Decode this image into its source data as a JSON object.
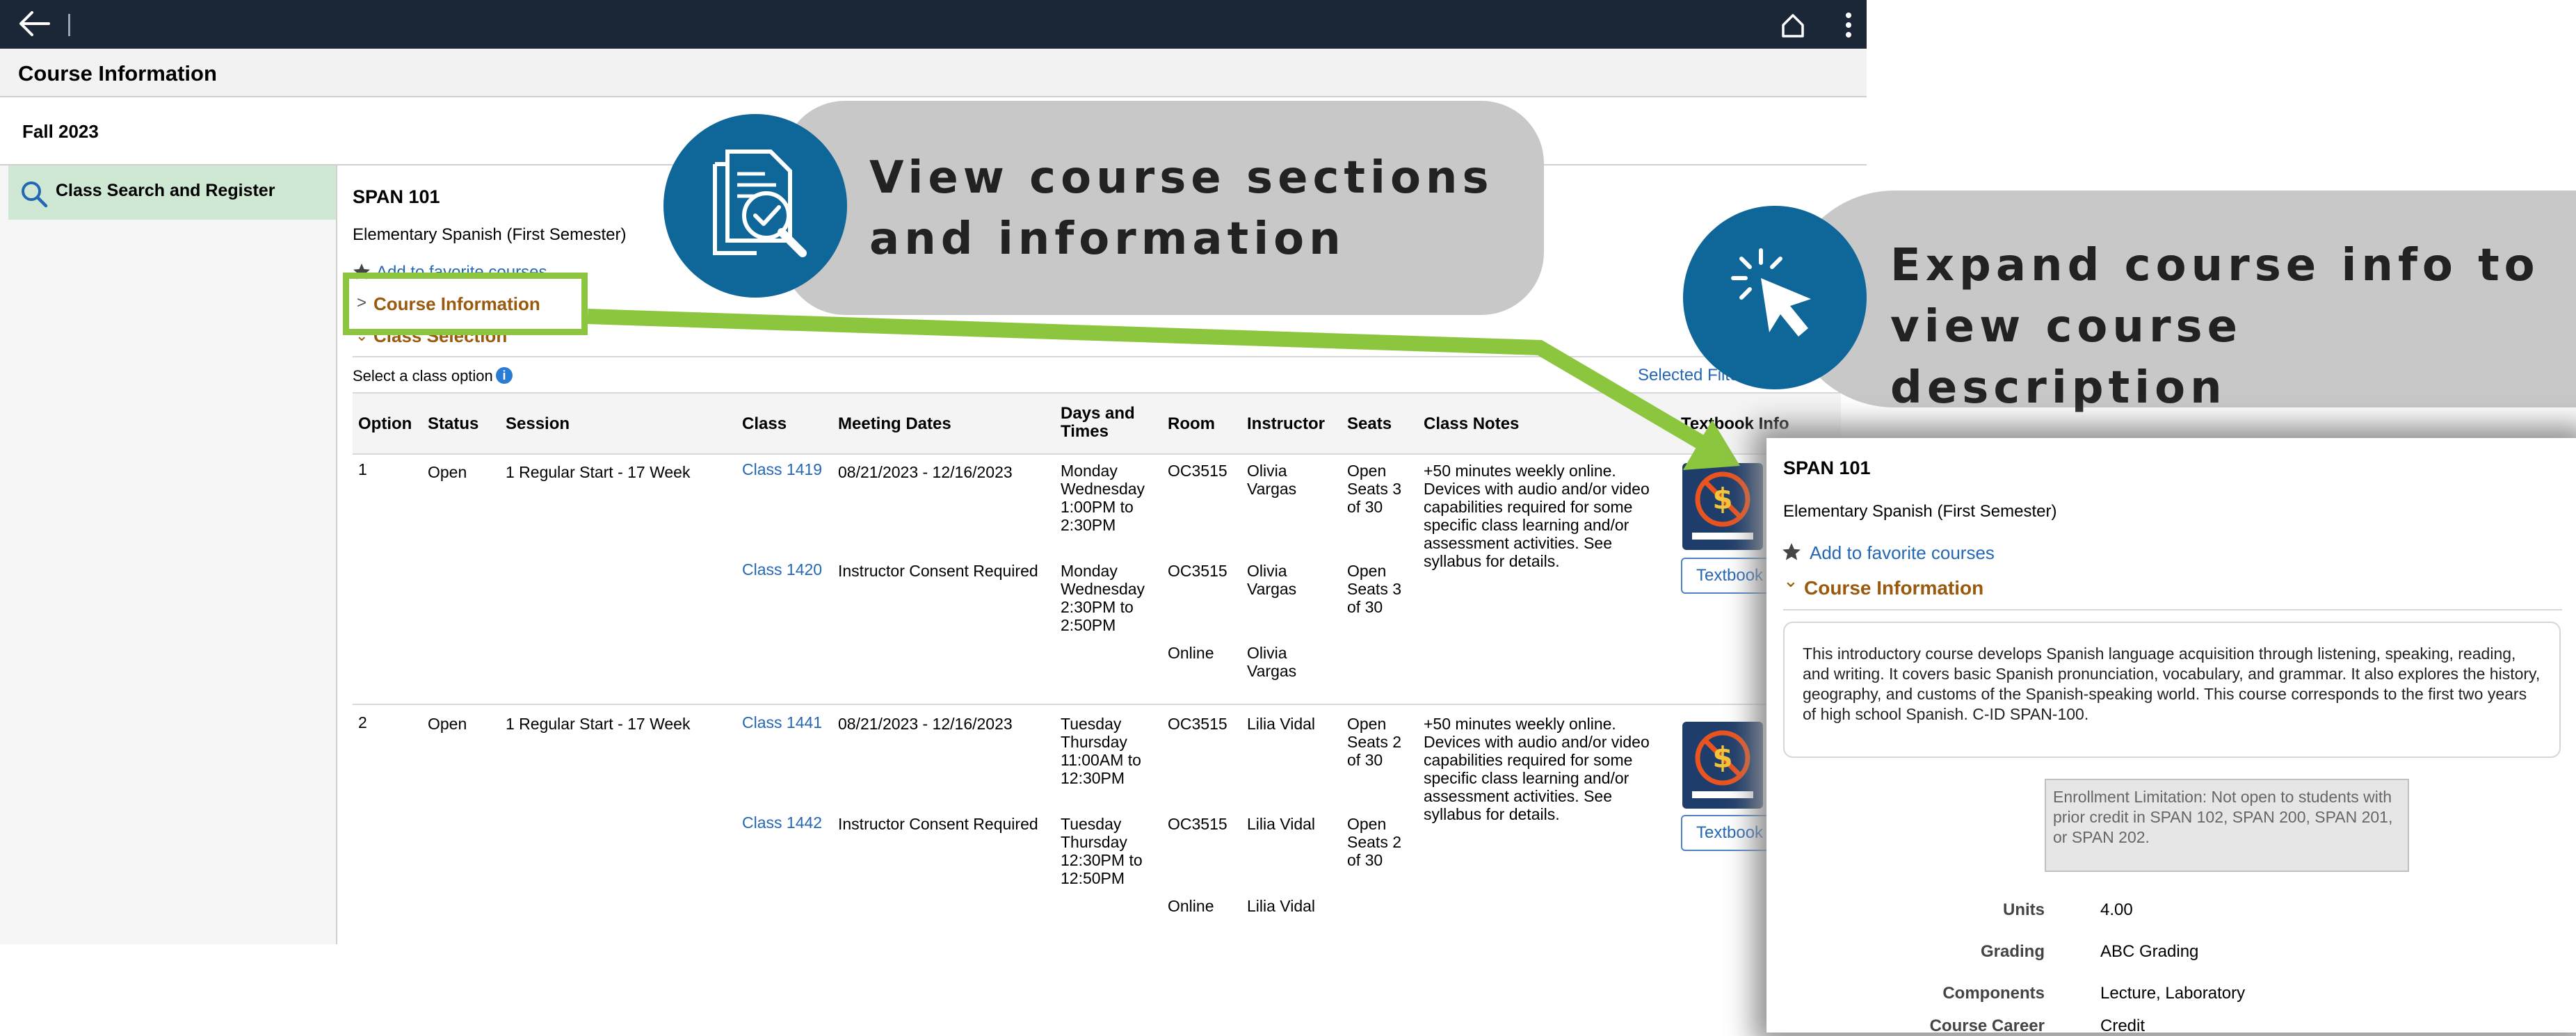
{
  "app": {
    "header_title": "Course Information",
    "term": "Fall 2023",
    "sidebar_item": "Class Search and Register"
  },
  "course": {
    "code": "SPAN 101",
    "title": "Elementary Spanish (First Semester)",
    "favorite_link": "Add to favorite courses",
    "course_info_label": "Course Information",
    "class_selection_label": "Class Selection",
    "select_option": "Select a class option",
    "selected_filters": "Selected Filters"
  },
  "table": {
    "headers": [
      "Option",
      "Status",
      "Session",
      "Class",
      "Meeting Dates",
      "Days and Times",
      "Room",
      "Instructor",
      "Seats",
      "Class Notes",
      "Textbook Info"
    ],
    "textbook_button": "Textbook Info",
    "rows": [
      {
        "option": "1",
        "status": "Open",
        "session": "1 Regular Start - 17 Week",
        "notes": "+50 minutes weekly online. Devices with audio and/or video capabilities required for some specific class learning and/or assessment activities. See syllabus for details.",
        "sections": [
          {
            "class": "Class 1419",
            "dates": "08/21/2023 - 12/16/2023",
            "days": "Monday Wednesday 1:00PM to 2:30PM",
            "room": "OC3515",
            "instructor": "Olivia Vargas",
            "seats": "Open Seats 3 of 30"
          },
          {
            "class": "Class 1420",
            "dates": "Instructor Consent Required",
            "days": "Monday Wednesday 2:30PM to 2:50PM",
            "room": "OC3515",
            "instructor": "Olivia Vargas",
            "seats": "Open Seats 3 of 30"
          },
          {
            "class": "",
            "dates": "",
            "days": "",
            "room": "Online",
            "instructor": "Olivia Vargas",
            "seats": ""
          }
        ]
      },
      {
        "option": "2",
        "status": "Open",
        "session": "1 Regular Start - 17 Week",
        "notes": "+50 minutes weekly online. Devices with audio and/or video capabilities required for some specific class learning and/or assessment activities. See syllabus for details.",
        "sections": [
          {
            "class": "Class 1441",
            "dates": "08/21/2023 - 12/16/2023",
            "days": "Tuesday Thursday 11:00AM to 12:30PM",
            "room": "OC3515",
            "instructor": "Lilia Vidal",
            "seats": "Open Seats 2 of 30"
          },
          {
            "class": "Class 1442",
            "dates": "Instructor Consent Required",
            "days": "Tuesday Thursday 12:30PM to 12:50PM",
            "room": "OC3515",
            "instructor": "Lilia Vidal",
            "seats": "Open Seats 2 of 30"
          },
          {
            "class": "",
            "dates": "",
            "days": "",
            "room": "Online",
            "instructor": "Lilia Vidal",
            "seats": ""
          }
        ]
      }
    ]
  },
  "callouts": {
    "first": "View course sections and information",
    "second": "Expand course info to view course description"
  },
  "detail": {
    "code": "SPAN 101",
    "title": "Elementary Spanish (First Semester)",
    "favorite": "Add to favorite courses",
    "section_label": "Course Information",
    "description": "This introductory course develops Spanish language acquisition through listening, speaking, reading, and writing. It covers basic Spanish pronunciation, vocabulary, and grammar. It also explores the history, geography, and customs of the Spanish-speaking world. This course corresponds to the first two years of high school Spanish. C-ID SPAN-100.",
    "enrollment_limitation": "Enrollment Limitation: Not open to students with prior credit in SPAN 102, SPAN 200, SPAN 201, or SPAN 202.",
    "fields": [
      {
        "label": "Units",
        "value": "4.00"
      },
      {
        "label": "Grading",
        "value": "ABC Grading"
      },
      {
        "label": "Components",
        "value": "Lecture, Laboratory"
      },
      {
        "label": "Course Career",
        "value": "Credit"
      }
    ]
  },
  "colors": {
    "topbar": "#1b2636",
    "sidebar_active": "#cfe8d4",
    "link_blue": "#2467b5",
    "section_brown": "#9a5a0e",
    "highlight_green": "#8cc63f",
    "callout_circle": "#0f6699",
    "callout_pill": "#c8c8c8"
  }
}
